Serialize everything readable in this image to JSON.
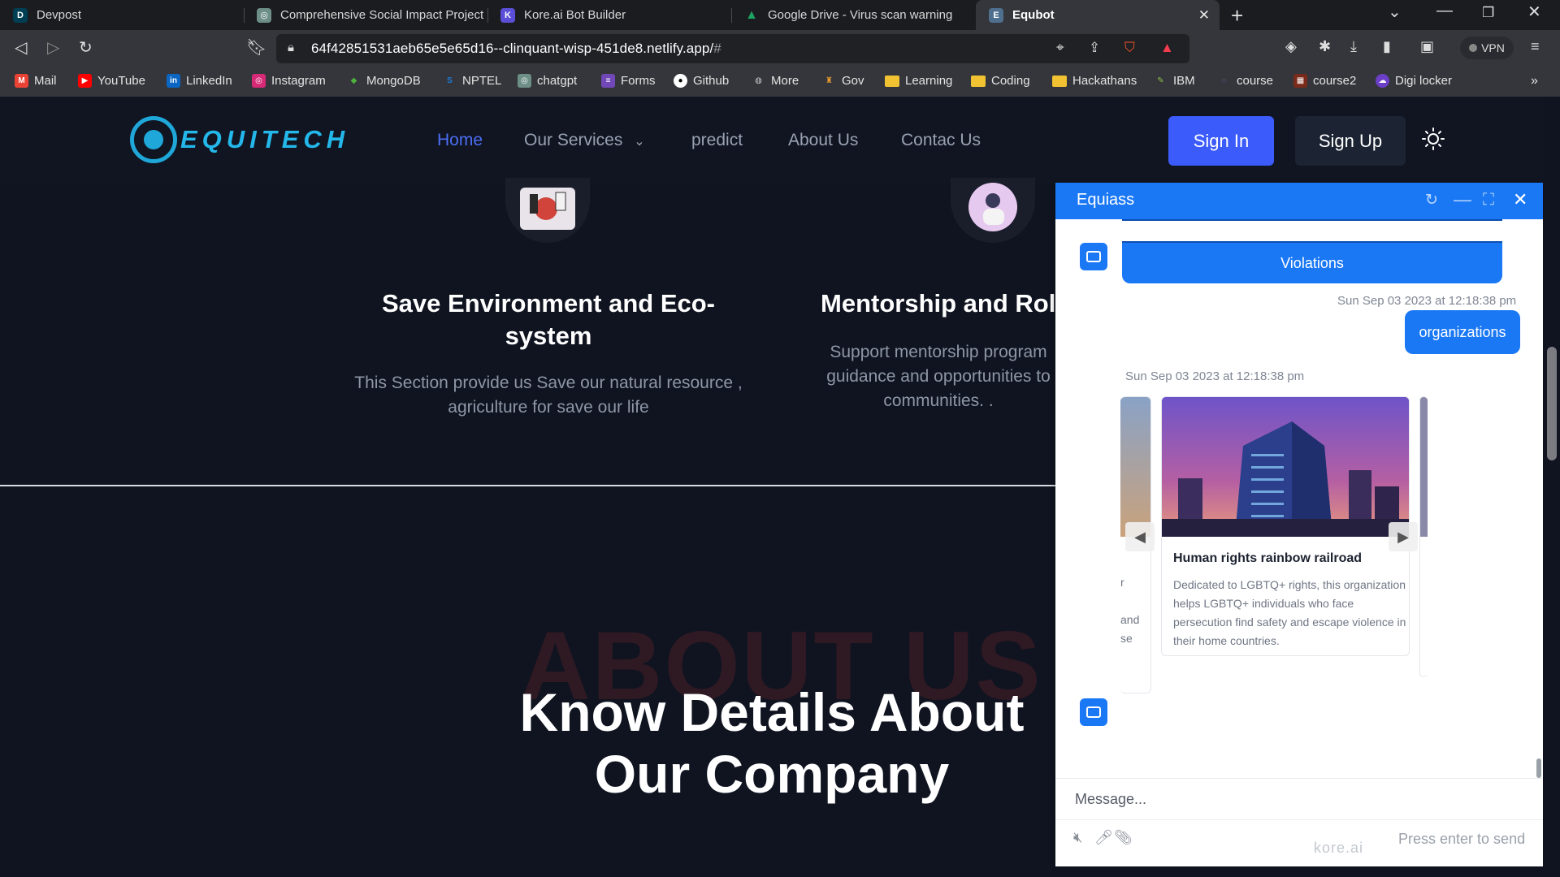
{
  "browser": {
    "tabs": [
      {
        "title": "Devpost",
        "favicon": "D",
        "color": "#003e54"
      },
      {
        "title": "Comprehensive Social Impact Project",
        "favicon": "◎",
        "color": "#6d8f86"
      },
      {
        "title": "Kore.ai Bot Builder",
        "favicon": "K",
        "color": "#5a4fd6"
      },
      {
        "title": "Google Drive - Virus scan warning",
        "favicon": "▲",
        "color": "#1ea362"
      },
      {
        "title": "Equbot",
        "favicon": "E",
        "color": "#4f6f8f"
      }
    ],
    "url": "64f42851531aeb65e5e65d16--clinquant-wisp-451de8.netlify.app/",
    "url_suffix": "#",
    "vpn_label": "VPN",
    "bookmarks": [
      "Mail",
      "YouTube",
      "LinkedIn",
      "Instagram",
      "MongoDB",
      "NPTEL",
      "chatgpt",
      "Forms",
      "Github",
      "More",
      "Gov",
      "Learning",
      "Coding",
      "Hackathans",
      "IBM",
      "course",
      "course2",
      "Digi locker"
    ]
  },
  "site": {
    "logo_text": "EQUITECH",
    "nav": [
      "Home",
      "Our Services",
      "predict",
      "About Us",
      "Contac Us"
    ],
    "sign_in": "Sign In",
    "sign_up": "Sign Up",
    "services": [
      {
        "title": "Save Environment and Eco-system",
        "desc": "This Section provide us Save our natural resource , agriculture for save our life"
      },
      {
        "title": "Mentorship and Rol",
        "desc": "Support mentorship program guidance and opportunities to communities. ."
      }
    ],
    "bg_word": "ABOUT US",
    "hero_title": "Know Details About Our Company"
  },
  "chat": {
    "title": "Equiass",
    "violations_button": "Violations",
    "timestamp_user": "Sun Sep 03 2023 at 12:18:38 pm",
    "user_message": "organizations",
    "timestamp_bot": "Sun Sep 03 2023 at 12:18:38 pm",
    "card": {
      "title": "Human rights rainbow railroad",
      "desc": "Dedicated to LGBTQ+ rights, this organization helps LGBTQ+ individuals who face persecution find safety and escape violence in their home countries."
    },
    "prev_card_fragments": [
      "r",
      "and",
      "se"
    ],
    "input_placeholder": "Message...",
    "send_hint": "Press enter to send",
    "powered_by": "kore.ai"
  }
}
